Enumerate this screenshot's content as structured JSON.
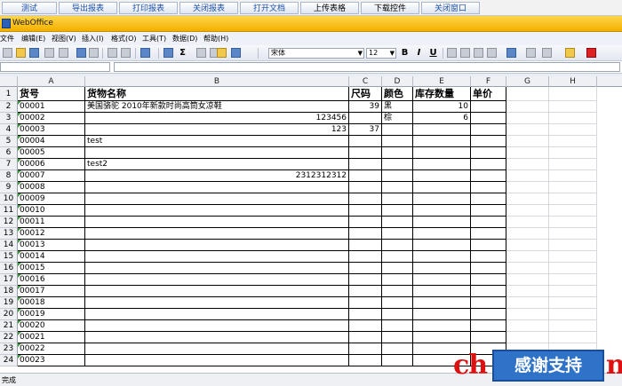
{
  "top_buttons": [
    "测试",
    "导出报表",
    "打印报表",
    "关闭报表",
    "打开文档",
    "上传表格",
    "下载控件",
    "关闭窗口"
  ],
  "window_title": "WebOffice",
  "menu": [
    "文件",
    "编辑(E)",
    "视图(V)",
    "插入(I)",
    "格式(O)",
    "工具(T)",
    "数据(D)",
    "帮助(H)"
  ],
  "toolbar": {
    "font_name": "宋体",
    "font_size": "12",
    "bold": "B",
    "italic": "I",
    "underline": "U",
    "sigma": "Σ"
  },
  "columns": [
    "A",
    "B",
    "C",
    "D",
    "E",
    "F",
    "G",
    "H"
  ],
  "header_row": [
    "货号",
    "货物名称",
    "尺码",
    "颜色",
    "库存数量",
    "单价"
  ],
  "rows": [
    [
      "00001",
      "美国骆驼 2010年新款时尚高筒女凉鞋",
      "39",
      "黑",
      "10",
      ""
    ],
    [
      "00002",
      "123456",
      "",
      "棕",
      "6",
      ""
    ],
    [
      "00003",
      "123",
      "37",
      "",
      "",
      ""
    ],
    [
      "00004",
      "test",
      "",
      "",
      "",
      ""
    ],
    [
      "00005",
      "",
      "",
      "",
      "",
      ""
    ],
    [
      "00006",
      "test2",
      "",
      "",
      "",
      ""
    ],
    [
      "00007",
      "2312312312",
      "",
      "",
      "",
      ""
    ],
    [
      "00008",
      "",
      "",
      "",
      "",
      ""
    ],
    [
      "00009",
      "",
      "",
      "",
      "",
      ""
    ],
    [
      "00010",
      "",
      "",
      "",
      "",
      ""
    ],
    [
      "00011",
      "",
      "",
      "",
      "",
      ""
    ],
    [
      "00012",
      "",
      "",
      "",
      "",
      ""
    ],
    [
      "00013",
      "",
      "",
      "",
      "",
      ""
    ],
    [
      "00014",
      "",
      "",
      "",
      "",
      ""
    ],
    [
      "00015",
      "",
      "",
      "",
      "",
      ""
    ],
    [
      "00016",
      "",
      "",
      "",
      "",
      ""
    ],
    [
      "00017",
      "",
      "",
      "",
      "",
      ""
    ],
    [
      "00018",
      "",
      "",
      "",
      "",
      ""
    ],
    [
      "00019",
      "",
      "",
      "",
      "",
      ""
    ],
    [
      "00020",
      "",
      "",
      "",
      "",
      ""
    ],
    [
      "00021",
      "",
      "",
      "",
      "",
      ""
    ],
    [
      "00022",
      "",
      "",
      "",
      "",
      ""
    ],
    [
      "00023",
      "",
      "",
      "",
      "",
      ""
    ]
  ],
  "status_text": "完成",
  "watermark": {
    "left": "ch",
    "box": "感谢支持",
    "right": "n"
  }
}
